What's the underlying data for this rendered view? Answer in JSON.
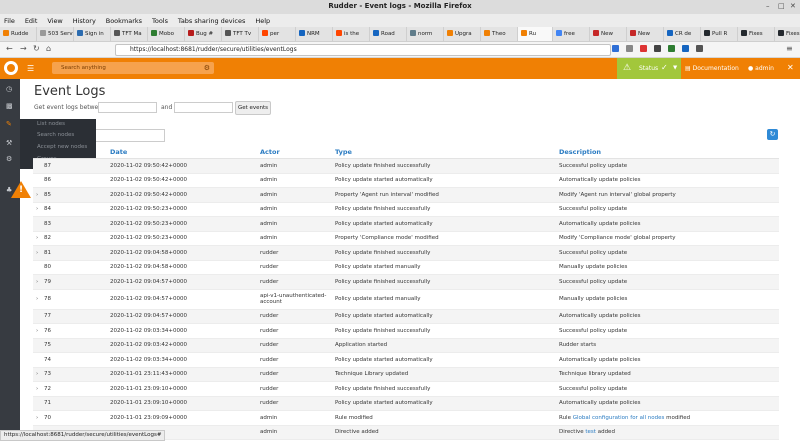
{
  "window": {
    "title": "Rudder - Event logs - Mozilla Firefox",
    "menu": [
      "File",
      "Edit",
      "View",
      "History",
      "Bookmarks",
      "Tools",
      "Tabs sharing devices",
      "Help"
    ]
  },
  "tabs": [
    {
      "label": "Rudde",
      "color": "#f08004"
    },
    {
      "label": "503 Servi",
      "color": "#999999"
    },
    {
      "label": "Sign in",
      "color": "#2c6cb0"
    },
    {
      "label": "TFT Ma",
      "color": "#555555"
    },
    {
      "label": "Mobo",
      "color": "#2e7d32"
    },
    {
      "label": "Bug #",
      "color": "#b71c1c"
    },
    {
      "label": "TFT Tv",
      "color": "#555555"
    },
    {
      "label": "per",
      "color": "#ff4500"
    },
    {
      "label": "NRM",
      "color": "#1565c0"
    },
    {
      "label": "is the",
      "color": "#ff4500"
    },
    {
      "label": "Road",
      "color": "#1565c0"
    },
    {
      "label": "norm",
      "color": "#607d8b"
    },
    {
      "label": "Upgra",
      "color": "#f08004"
    },
    {
      "label": "Theo",
      "color": "#f08004"
    },
    {
      "label": "Ru",
      "color": "#f08004",
      "active": true
    },
    {
      "label": "free",
      "color": "#4285f4"
    },
    {
      "label": "New",
      "color": "#c62828"
    },
    {
      "label": "New",
      "color": "#c62828"
    },
    {
      "label": "CR de",
      "color": "#1565c0"
    },
    {
      "label": "Pull R",
      "color": "#24292e"
    },
    {
      "label": "Fixes",
      "color": "#24292e"
    },
    {
      "label": "Fixes",
      "color": "#24292e"
    }
  ],
  "navbar": {
    "url": "https://localhost:8681/rudder/secure/utilities/eventLogs"
  },
  "header": {
    "search_placeholder": "Search anything",
    "status_label": "Status",
    "documentation_label": "Documentation",
    "admin_label": "admin"
  },
  "flyout": [
    "List nodes",
    "Search nodes",
    "Accept new nodes",
    "Groups"
  ],
  "page": {
    "title": "Event Logs",
    "between_label": "Get event logs between",
    "and_label": "and",
    "get_button": "Get events"
  },
  "table": {
    "headers": [
      "Date",
      "Actor",
      "Type",
      "Description"
    ],
    "rows": [
      {
        "id": "87",
        "caret": false,
        "date": "2020-11-02 09:50:42+0000",
        "actor": "admin",
        "type": "Policy update finished successfully",
        "desc": "Successful policy update"
      },
      {
        "id": "86",
        "caret": false,
        "date": "2020-11-02 09:50:42+0000",
        "actor": "admin",
        "type": "Policy update started automatically",
        "desc": "Automatically update policies"
      },
      {
        "id": "85",
        "caret": true,
        "date": "2020-11-02 09:50:42+0000",
        "actor": "admin",
        "type": "Property 'Agent run interval' modified",
        "desc": "Modify 'Agent run interval' global property"
      },
      {
        "id": "84",
        "caret": true,
        "date": "2020-11-02 09:50:23+0000",
        "actor": "admin",
        "type": "Policy update finished successfully",
        "desc": "Successful policy update"
      },
      {
        "id": "83",
        "caret": false,
        "date": "2020-11-02 09:50:23+0000",
        "actor": "admin",
        "type": "Policy update started automatically",
        "desc": "Automatically update policies"
      },
      {
        "id": "82",
        "caret": true,
        "date": "2020-11-02 09:50:23+0000",
        "actor": "admin",
        "type": "Property 'Compliance mode' modified",
        "desc": "Modify 'Compliance mode' global property"
      },
      {
        "id": "81",
        "caret": true,
        "date": "2020-11-02 09:04:58+0000",
        "actor": "rudder",
        "type": "Policy update finished successfully",
        "desc": "Successful policy update"
      },
      {
        "id": "80",
        "caret": false,
        "date": "2020-11-02 09:04:58+0000",
        "actor": "rudder",
        "type": "Policy update started manually",
        "desc": "Manually update policies"
      },
      {
        "id": "79",
        "caret": true,
        "date": "2020-11-02 09:04:57+0000",
        "actor": "rudder",
        "type": "Policy update finished successfully",
        "desc": "Successful policy update"
      },
      {
        "id": "78",
        "caret": true,
        "date": "2020-11-02 09:04:57+0000",
        "actor": "api-v1-unauthenticated-account",
        "type": "Policy update started manually",
        "desc": "Manually update policies",
        "tall": true
      },
      {
        "id": "77",
        "caret": false,
        "date": "2020-11-02 09:04:57+0000",
        "actor": "rudder",
        "type": "Policy update started automatically",
        "desc": "Automatically update policies"
      },
      {
        "id": "76",
        "caret": true,
        "date": "2020-11-02 09:03:34+0000",
        "actor": "rudder",
        "type": "Policy update finished successfully",
        "desc": "Successful policy update"
      },
      {
        "id": "75",
        "caret": false,
        "date": "2020-11-02 09:03:42+0000",
        "actor": "rudder",
        "type": "Application started",
        "desc": "Rudder starts"
      },
      {
        "id": "74",
        "caret": false,
        "date": "2020-11-02 09:03:34+0000",
        "actor": "rudder",
        "type": "Policy update started automatically",
        "desc": "Automatically update policies"
      },
      {
        "id": "73",
        "caret": true,
        "date": "2020-11-01 23:11:43+0000",
        "actor": "rudder",
        "type": "Technique Library updated",
        "desc": "Technique library updated"
      },
      {
        "id": "72",
        "caret": true,
        "date": "2020-11-01 23:09:10+0000",
        "actor": "rudder",
        "type": "Policy update finished successfully",
        "desc": "Successful policy update"
      },
      {
        "id": "71",
        "caret": false,
        "date": "2020-11-01 23:09:10+0000",
        "actor": "rudder",
        "type": "Policy update started automatically",
        "desc": "Automatically update policies"
      },
      {
        "id": "70",
        "caret": true,
        "date": "2020-11-01 23:09:09+0000",
        "actor": "admin",
        "type": "Rule modified",
        "desc": "Rule",
        "desc_link": "Global configuration for all nodes",
        "desc_suffix": "modified"
      },
      {
        "id": "",
        "caret": false,
        "date": "",
        "actor": "admin",
        "type": "Directive added",
        "desc": "Directive",
        "desc_link": "test",
        "desc_suffix": "added"
      }
    ]
  },
  "status_link": "https://localhost:8681/rudder/secure/utilities/eventLogs#"
}
